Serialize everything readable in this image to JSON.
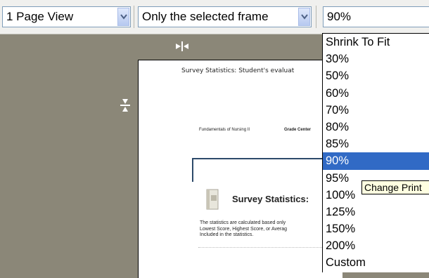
{
  "toolbar": {
    "view_select": {
      "value": "1 Page View"
    },
    "frame_select": {
      "value": "Only the selected frame"
    },
    "zoom_select": {
      "value": "90%"
    }
  },
  "page_preview": {
    "doc_title": "Survey Statistics: Student's evaluat",
    "breadcrumb_course": "Fundamentals of Nursing II",
    "breadcrumb_grade": "Grade Center",
    "section_title": "Survey Statistics:",
    "body_lines": [
      "The statistics are calculated based only",
      "Lowest Score, Highest Score, or Averag",
      "Included in the statistics."
    ]
  },
  "zoom_dropdown": {
    "options": [
      "Shrink To Fit",
      "30%",
      "50%",
      "60%",
      "70%",
      "80%",
      "85%",
      "90%",
      "95%",
      "100%",
      "125%",
      "150%",
      "200%",
      "Custom"
    ],
    "highlighted": "90%"
  },
  "tooltip": {
    "text": "Change Print"
  },
  "icons": [
    "chevron-down-icon",
    "resize-horizontal-icon",
    "resize-vertical-icon",
    "book-icon"
  ],
  "colors": {
    "selection": "#316ac5",
    "toolbar": "#f0f0ee",
    "backdrop": "#8b8778",
    "tooltip": "#ffffe1"
  }
}
